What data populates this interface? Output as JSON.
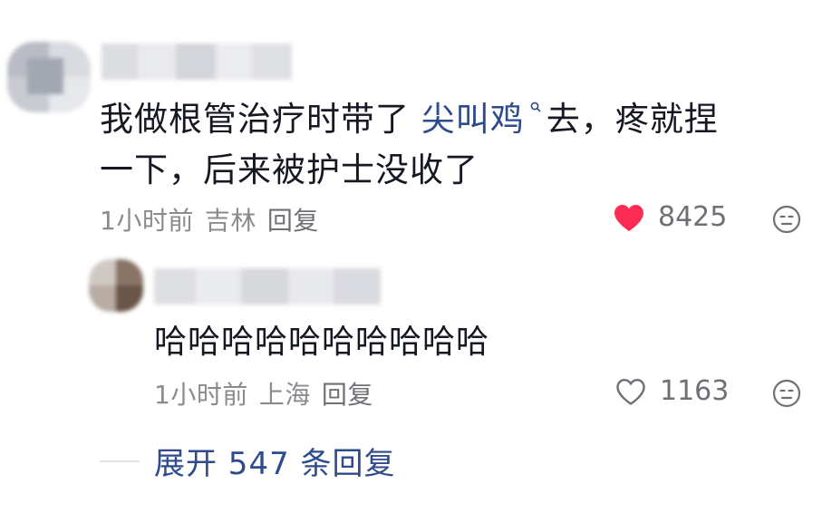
{
  "comments": [
    {
      "text_before": "我做根管治疗时带了 ",
      "link_text": "尖叫鸡",
      "text_after": " 去，疼就捏一下，后来被护士没收了",
      "line2": "一下，后来被护士没收了",
      "line1_after": "去，疼就捏",
      "time": "1小时前",
      "location": "吉林",
      "reply_label": "回复",
      "likes": "8425",
      "liked": true
    },
    {
      "text": "哈哈哈哈哈哈哈哈哈哈",
      "time": "1小时前",
      "location": "上海",
      "reply_label": "回复",
      "likes": "1163",
      "liked": false
    }
  ],
  "expand_replies": "展开 547 条回复",
  "colors": {
    "link": "#2e4b8c",
    "like_red": "#fe2c55",
    "meta_gray": "#8a8a8f"
  },
  "icons": {
    "like_filled": "heart-filled-icon",
    "like_outline": "heart-outline-icon",
    "dislike": "dislike-face-icon",
    "search_mark": "search-icon"
  }
}
